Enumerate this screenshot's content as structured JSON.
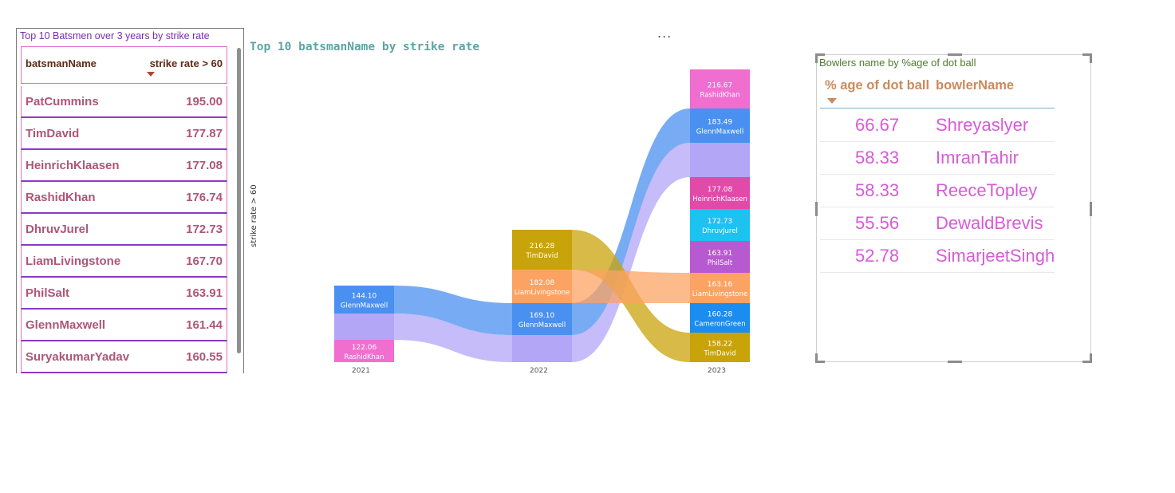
{
  "batsmen_table": {
    "title": "Top 10 Batsmen over 3 years by strike rate",
    "col_name": "batsmanName",
    "col_value": "strike rate > 60",
    "rows": [
      {
        "name": "PatCummins",
        "value": "195.00"
      },
      {
        "name": "TimDavid",
        "value": "177.87"
      },
      {
        "name": "HeinrichKlaasen",
        "value": "177.08"
      },
      {
        "name": "RashidKhan",
        "value": "176.74"
      },
      {
        "name": "DhruvJurel",
        "value": "172.73"
      },
      {
        "name": "LiamLivingstone",
        "value": "167.70"
      },
      {
        "name": "PhilSalt",
        "value": "163.91"
      },
      {
        "name": "GlennMaxwell",
        "value": "161.44"
      },
      {
        "name": "SuryakumarYadav",
        "value": "160.55"
      }
    ]
  },
  "ribbon_chart": {
    "more_options": "...",
    "title": "Top 10 batsmanName by strike rate",
    "ylabel": "strike rate > 60"
  },
  "chart_data": {
    "type": "area",
    "subtype": "ribbon",
    "title": "Top 10 batsmanName by strike rate",
    "xlabel": "",
    "ylabel": "strike rate > 60",
    "categories": [
      "2021",
      "2022",
      "2023"
    ],
    "columns": [
      {
        "year": "2021",
        "segments": [
          {
            "name": "GlennMaxwell",
            "value": 144.1,
            "label": "144.10",
            "color": "#4a90f0"
          },
          {
            "name": "",
            "value": null,
            "label": "",
            "color": "#b3a6f7"
          },
          {
            "name": "RashidKhan",
            "value": 122.06,
            "label": "122.06",
            "color": "#f06ed0"
          }
        ]
      },
      {
        "year": "2022",
        "segments": [
          {
            "name": "TimDavid",
            "value": 216.28,
            "label": "216.28",
            "color": "#c9a30a"
          },
          {
            "name": "LiamLivingstone",
            "value": 182.08,
            "label": "182.08",
            "color": "#fca363"
          },
          {
            "name": "GlennMaxwell",
            "value": 169.1,
            "label": "169.10",
            "color": "#4a90f0"
          },
          {
            "name": "",
            "value": null,
            "label": "",
            "color": "#b3a6f7"
          }
        ]
      },
      {
        "year": "2023",
        "segments": [
          {
            "name": "RashidKhan",
            "value": 216.67,
            "label": "216.67",
            "color": "#f06ed0"
          },
          {
            "name": "GlennMaxwell",
            "value": 183.49,
            "label": "183.49",
            "color": "#4a90f0"
          },
          {
            "name": "",
            "value": null,
            "label": "",
            "color": "#b3a6f7"
          },
          {
            "name": "HeinrichKlaasen",
            "value": 177.08,
            "label": "177.08",
            "color": "#e14aa8"
          },
          {
            "name": "DhruvJurel",
            "value": 172.73,
            "label": "172.73",
            "color": "#1cc2f0"
          },
          {
            "name": "PhilSalt",
            "value": 163.91,
            "label": "163.91",
            "color": "#b75ad1"
          },
          {
            "name": "LiamLivingstone",
            "value": 163.16,
            "label": "163.16",
            "color": "#fca363"
          },
          {
            "name": "CameronGreen",
            "value": 160.28,
            "label": "160.28",
            "color": "#1b8cf0"
          },
          {
            "name": "TimDavid",
            "value": 158.22,
            "label": "158.22",
            "color": "#c9a30a"
          }
        ]
      }
    ],
    "ribbons": [
      {
        "name": "GlennMaxwell",
        "color": "#4a90f0"
      },
      {
        "name": "",
        "color": "#b3a6f7"
      },
      {
        "name": "TimDavid",
        "color": "#c9a30a"
      },
      {
        "name": "LiamLivingstone",
        "color": "#fca363"
      }
    ]
  },
  "bowlers_table": {
    "title": "Bowlers name by %age of dot ball",
    "col_value": "% age of dot ball",
    "col_name": "bowlerName",
    "rows": [
      {
        "value": "66.67",
        "name": "Shreyaslyer"
      },
      {
        "value": "58.33",
        "name": "ImranTahir"
      },
      {
        "value": "58.33",
        "name": "ReeceTopley"
      },
      {
        "value": "55.56",
        "name": "DewaldBrevis"
      },
      {
        "value": "52.78",
        "name": "SimarjeetSingh"
      }
    ]
  }
}
